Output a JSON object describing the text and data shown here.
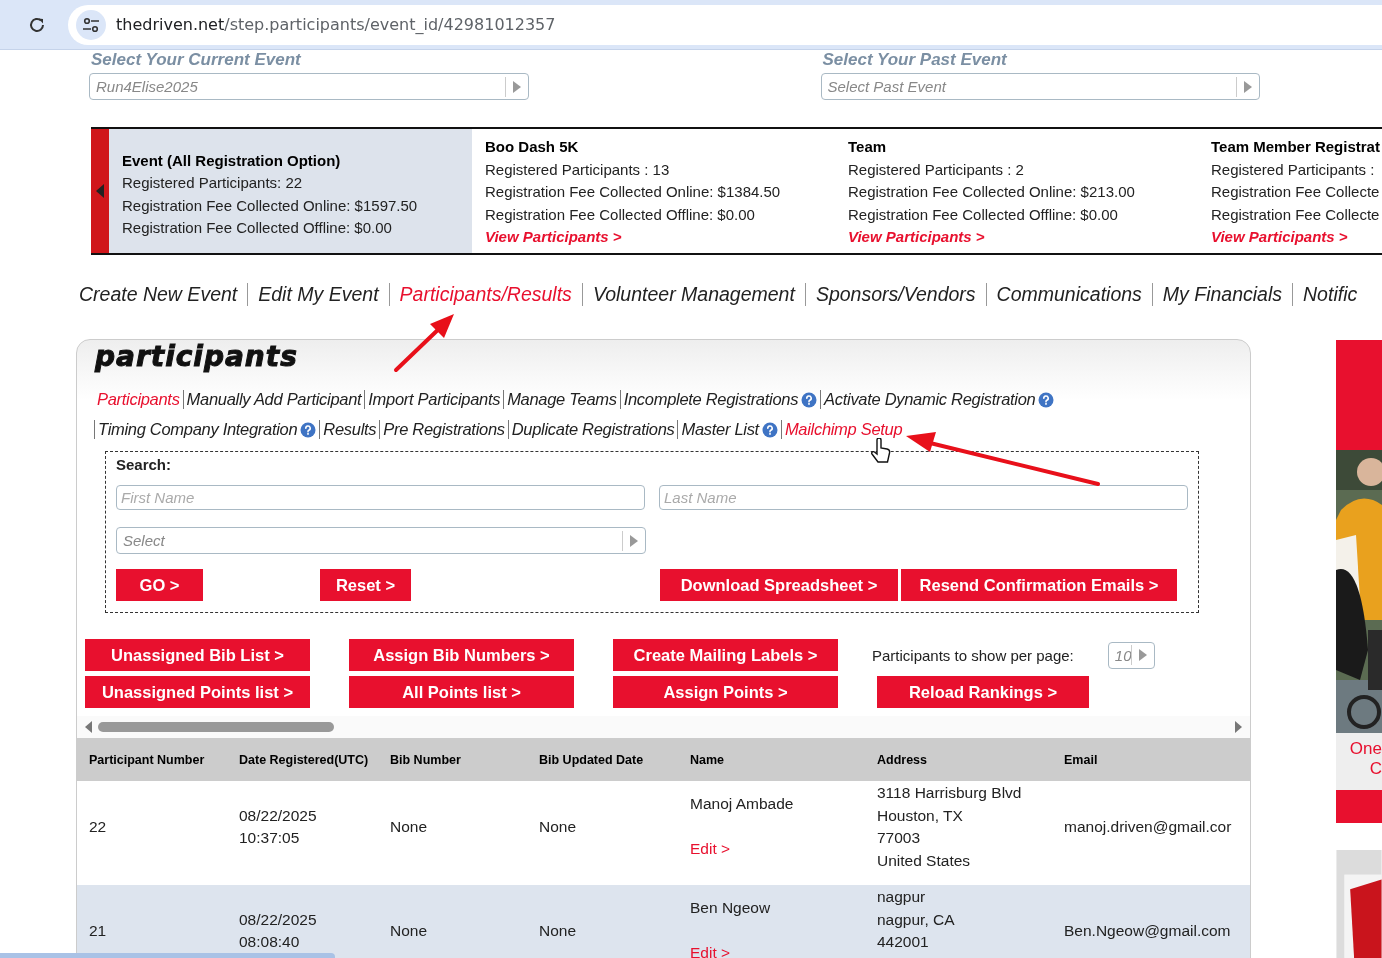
{
  "browser": {
    "url_domain": "thedriven.net",
    "url_path": "/step.participants/event_id/42981012357"
  },
  "event_select": {
    "current_label": "Select Your Current Event",
    "current_value": "Run4Elise2025",
    "past_label": "Select Your Past Event",
    "past_placeholder": "Select Past Event"
  },
  "event_cards": [
    {
      "title": "Event (All Registration Option)",
      "lines": [
        "Registered Participants: 22",
        "Registration Fee Collected Online: $1597.50",
        "Registration Fee Collected Offline: $0.00"
      ],
      "selected": true
    },
    {
      "title": "Boo Dash 5K",
      "lines": [
        "Registered Participants : 13",
        "Registration Fee Collected Online: $1384.50",
        "Registration Fee Collected Offline: $0.00"
      ],
      "link": "View Participants >",
      "selected": false
    },
    {
      "title": "Team",
      "lines": [
        "Registered Participants : 2",
        "Registration Fee Collected Online: $213.00",
        "Registration Fee Collected Offline: $0.00"
      ],
      "link": "View Participants >",
      "selected": false
    },
    {
      "title": "Team Member Registrat",
      "lines": [
        "Registered Participants :",
        "Registration Fee Collecte",
        "Registration Fee Collecte"
      ],
      "link": "View Participants >",
      "selected": false
    }
  ],
  "nav": [
    {
      "label": "Create New Event",
      "selected": false
    },
    {
      "label": "Edit My Event",
      "selected": false
    },
    {
      "label": "Participants/Results",
      "selected": true
    },
    {
      "label": "Volunteer Management",
      "selected": false
    },
    {
      "label": "Sponsors/Vendors",
      "selected": false
    },
    {
      "label": "Communications",
      "selected": false
    },
    {
      "label": "My Financials",
      "selected": false
    },
    {
      "label": "Notific",
      "selected": false
    }
  ],
  "panel": {
    "title": "participants",
    "link_rows": [
      [
        {
          "label": "Participants",
          "selected": true,
          "help": false
        },
        {
          "label": "Manually Add Participant",
          "selected": false,
          "help": false
        },
        {
          "label": "Import Participants",
          "selected": false,
          "help": false
        },
        {
          "label": "Manage Teams",
          "selected": false,
          "help": false
        },
        {
          "label": "Incomplete Registrations",
          "selected": false,
          "help": true
        },
        {
          "label": "Activate Dynamic Registration",
          "selected": false,
          "help": true
        }
      ],
      [
        {
          "label": "Timing Company Integration",
          "selected": false,
          "help": true
        },
        {
          "label": "Results",
          "selected": false,
          "help": false
        },
        {
          "label": "Pre Registrations",
          "selected": false,
          "help": false
        },
        {
          "label": "Duplicate Registrations",
          "selected": false,
          "help": false
        },
        {
          "label": "Master List",
          "selected": false,
          "help": true
        },
        {
          "label": "Mailchimp Setup",
          "selected": true,
          "help": false
        }
      ]
    ],
    "search": {
      "label": "Search:",
      "first_name": {
        "placeholder": "First Name"
      },
      "last_name": {
        "placeholder": "Last Name"
      },
      "select": {
        "placeholder": "Select"
      },
      "left_buttons": [
        "GO >",
        "Reset >"
      ],
      "right_buttons": [
        "Download Spreadsheet >",
        "Resend Confirmation Emails >"
      ]
    },
    "action_buttons": [
      [
        "Unassigned Bib List >",
        "Assign Bib Numbers >",
        "Create Mailing Labels >"
      ],
      [
        "Unassigned Points list >",
        "All Points list >",
        "Assign Points >",
        "Reload Rankings >"
      ]
    ],
    "per_page": {
      "label": "Participants to show per page:",
      "value": "10"
    }
  },
  "table": {
    "columns": [
      "Participant Number",
      "Date Registered(UTC)",
      "Bib Number",
      "Bib Updated Date",
      "Name",
      "Address",
      "Email"
    ],
    "rows": [
      {
        "number": "22",
        "date": [
          "08/22/2025",
          "10:37:05"
        ],
        "bib": "None",
        "bib_date": "None",
        "name": "Manoj Ambade",
        "edit": "Edit >",
        "address": [
          "3118 Harrisburg Blvd",
          "Houston, TX",
          "77003",
          "United States"
        ],
        "email": "manoj.driven@gmail.cor"
      },
      {
        "number": "21",
        "date": [
          "08/22/2025",
          "08:08:40"
        ],
        "bib": "None",
        "bib_date": "None",
        "name": "Ben Ngeow",
        "edit": "Edit >",
        "address": [
          "nagpur",
          "nagpur, CA",
          "442001"
        ],
        "email": "Ben.Ngeow@gmail.com"
      }
    ]
  },
  "ad": {
    "lines": [
      "One",
      "C"
    ]
  }
}
